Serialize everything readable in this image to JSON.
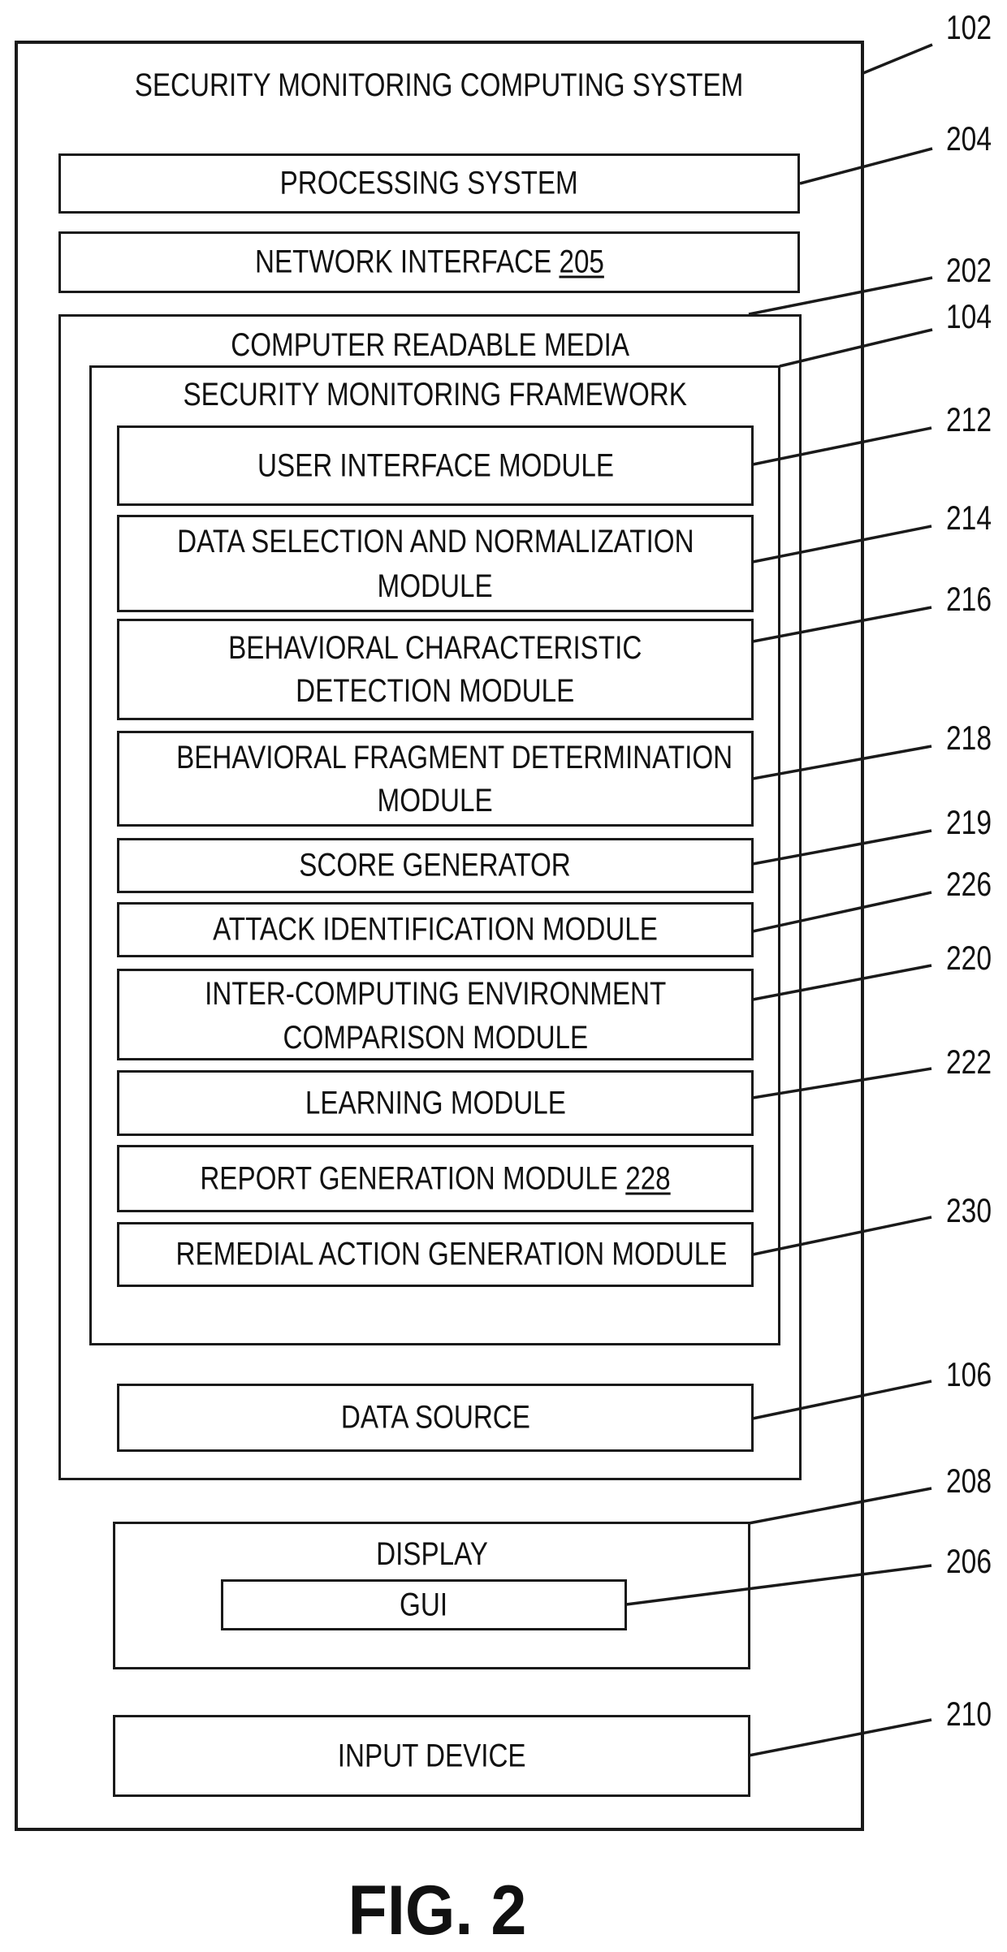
{
  "figure": {
    "caption": "FIG. 2"
  },
  "system": {
    "title": "SECURITY MONITORING COMPUTING SYSTEM",
    "ref": "102"
  },
  "processing_system": {
    "label": "PROCESSING SYSTEM",
    "ref": "204"
  },
  "network_interface": {
    "label": "NETWORK INTERFACE",
    "inline_ref": "205"
  },
  "computer_readable_media": {
    "label": "COMPUTER READABLE MEDIA",
    "ref": "202"
  },
  "framework": {
    "label": "SECURITY MONITORING FRAMEWORK",
    "ref": "104",
    "modules": [
      {
        "lines": [
          "USER INTERFACE MODULE"
        ],
        "ref": "212"
      },
      {
        "lines": [
          "DATA SELECTION AND NORMALIZATION",
          "MODULE"
        ],
        "ref": "214"
      },
      {
        "lines": [
          "BEHAVIORAL CHARACTERISTIC",
          "DETECTION MODULE"
        ],
        "ref": "216"
      },
      {
        "lines": [
          "BEHAVIORAL FRAGMENT DETERMINATION",
          "MODULE"
        ],
        "ref": "218"
      },
      {
        "lines": [
          "SCORE GENERATOR"
        ],
        "ref": "219"
      },
      {
        "lines": [
          "ATTACK IDENTIFICATION MODULE"
        ],
        "ref": "226"
      },
      {
        "lines": [
          "INTER-COMPUTING ENVIRONMENT",
          "COMPARISON MODULE"
        ],
        "ref": "220"
      },
      {
        "lines": [
          "LEARNING MODULE"
        ],
        "ref": "222"
      },
      {
        "lines": [
          "REPORT GENERATION MODULE"
        ],
        "inline_ref": "228"
      },
      {
        "lines": [
          "REMEDIAL ACTION GENERATION MODULE"
        ],
        "ref": "230"
      }
    ]
  },
  "data_source": {
    "label": "DATA SOURCE",
    "ref": "106"
  },
  "display": {
    "label": "DISPLAY",
    "ref": "208",
    "gui": {
      "label": "GUI",
      "ref": "206"
    }
  },
  "input_device": {
    "label": "INPUT DEVICE",
    "ref": "210"
  }
}
